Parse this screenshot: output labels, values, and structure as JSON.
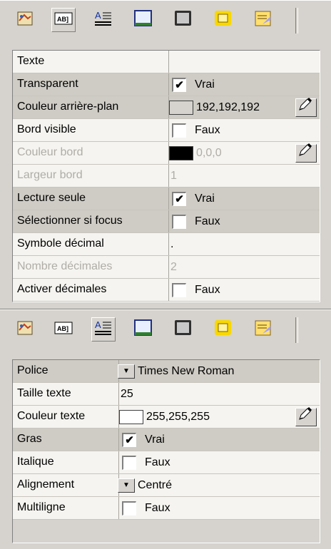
{
  "top_panel": {
    "rows": [
      {
        "label": "Texte",
        "kind": "text",
        "value": "",
        "disabled": false,
        "alt": false
      },
      {
        "label": "Transparent",
        "kind": "checkbox",
        "checked": true,
        "value": "Vrai",
        "disabled": false,
        "alt": true
      },
      {
        "label": "Couleur arrière-plan",
        "kind": "color",
        "swatch": "#d6d3ce",
        "value": "192,192,192",
        "disabled": false,
        "alt": true
      },
      {
        "label": "Bord visible",
        "kind": "checkbox",
        "checked": false,
        "value": "Faux",
        "disabled": false,
        "alt": false
      },
      {
        "label": "Couleur bord",
        "kind": "color",
        "swatch": "#000000",
        "value": "0,0,0",
        "disabled": true,
        "alt": false
      },
      {
        "label": "Largeur bord",
        "kind": "text",
        "value": "1",
        "disabled": true,
        "alt": false
      },
      {
        "label": "Lecture seule",
        "kind": "checkbox",
        "checked": true,
        "value": "Vrai",
        "disabled": false,
        "alt": true
      },
      {
        "label": "Sélectionner si focus",
        "kind": "checkbox",
        "checked": false,
        "value": "Faux",
        "disabled": false,
        "alt": true
      },
      {
        "label": "Symbole décimal",
        "kind": "text",
        "value": ".",
        "disabled": false,
        "alt": false
      },
      {
        "label": "Nombre décimales",
        "kind": "text",
        "value": "2",
        "disabled": true,
        "alt": false
      },
      {
        "label": "Activer décimales",
        "kind": "checkbox",
        "checked": false,
        "value": "Faux",
        "disabled": false,
        "alt": false
      }
    ]
  },
  "bottom_panel": {
    "rows": [
      {
        "label": "Police",
        "kind": "dropdown",
        "value": "Times New Roman",
        "disabled": false,
        "alt": true
      },
      {
        "label": "Taille texte",
        "kind": "text",
        "value": "25",
        "disabled": false,
        "alt": false
      },
      {
        "label": "Couleur texte",
        "kind": "color",
        "swatch": "#ffffff",
        "value": "255,255,255",
        "disabled": false,
        "alt": false
      },
      {
        "label": "Gras",
        "kind": "checkbox",
        "checked": true,
        "value": "Vrai",
        "disabled": false,
        "alt": true
      },
      {
        "label": "Italique",
        "kind": "checkbox",
        "checked": false,
        "value": "Faux",
        "disabled": false,
        "alt": false
      },
      {
        "label": "Alignement",
        "kind": "dropdown",
        "value": "Centré",
        "disabled": false,
        "alt": false
      },
      {
        "label": "Multiligne",
        "kind": "checkbox",
        "checked": false,
        "value": "Faux",
        "disabled": false,
        "alt": false
      }
    ]
  },
  "toolbar": {
    "icons": [
      "object-icon",
      "textfield-icon",
      "text-format-icon",
      "frame-icon",
      "window-icon",
      "button-icon",
      "note-icon"
    ],
    "active_top": 1,
    "active_bottom": 2
  }
}
